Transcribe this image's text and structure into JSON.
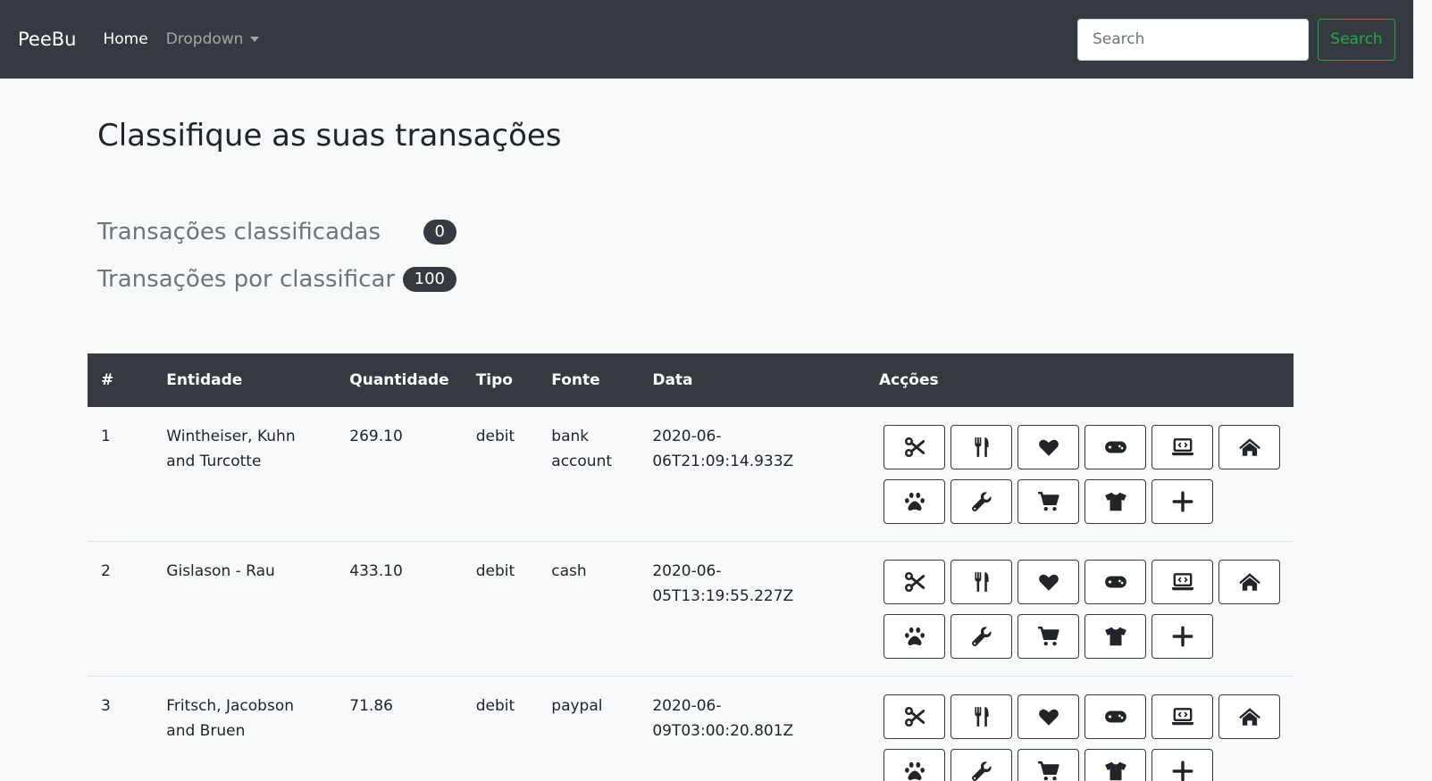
{
  "navbar": {
    "brand": "PeeBu",
    "home": "Home",
    "dropdown": "Dropdown",
    "search_placeholder": "Search",
    "search_button": "Search"
  },
  "page": {
    "title": "Classifique as suas transações"
  },
  "stats": {
    "classified_label": "Transações classificadas",
    "classified_count": "0",
    "unclassified_label": "Transações por classificar",
    "unclassified_count": "100"
  },
  "table": {
    "headers": [
      "#",
      "Entidade",
      "Quantidade",
      "Tipo",
      "Fonte",
      "Data",
      "Acções"
    ],
    "rows": [
      {
        "id": "1",
        "entity": "Wintheiser, Kuhn and Turcotte",
        "amount": "269.10",
        "type": "debit",
        "source": "bank account",
        "date": "2020-06-06T21:09:14.933Z"
      },
      {
        "id": "2",
        "entity": "Gislason - Rau",
        "amount": "433.10",
        "type": "debit",
        "source": "cash",
        "date": "2020-06-05T13:19:55.227Z"
      },
      {
        "id": "3",
        "entity": "Fritsch, Jacobson and Bruen",
        "amount": "71.86",
        "type": "debit",
        "source": "paypal",
        "date": "2020-06-09T03:00:20.801Z"
      }
    ]
  },
  "action_icons": [
    "scissors-icon",
    "utensils-icon",
    "heart-icon",
    "gamepad-icon",
    "laptop-code-icon",
    "home-icon",
    "paw-icon",
    "wrench-icon",
    "cart-icon",
    "tshirt-icon",
    "plus-icon"
  ],
  "colors": {
    "navbar": "#343a40",
    "success": "#28a745",
    "background": "#f8f9fa"
  }
}
